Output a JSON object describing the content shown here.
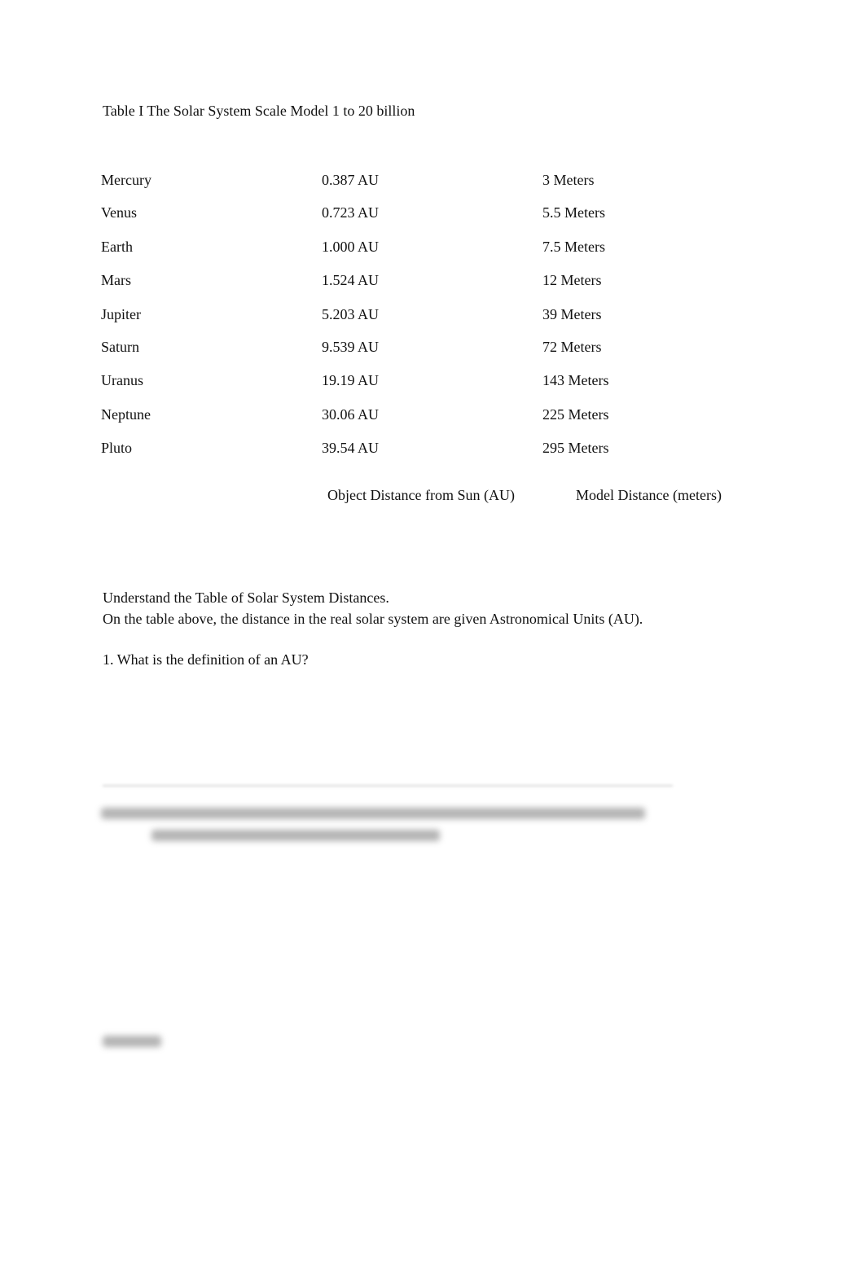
{
  "document": {
    "table_title": "Table I The Solar System Scale Model 1 to 20 billion",
    "table": {
      "columns": [
        "",
        "Object Distance from Sun (AU)",
        "Model Distance (meters)"
      ],
      "rows": [
        {
          "object": "Mercury",
          "au": "0.387 AU",
          "model": "3 Meters"
        },
        {
          "object": "Venus",
          "au": "0.723 AU",
          "model": "5.5 Meters"
        },
        {
          "object": "Earth",
          "au": "1.000 AU",
          "model": "7.5 Meters"
        },
        {
          "object": "Mars",
          "au": "1.524 AU",
          "model": "12 Meters"
        },
        {
          "object": "Jupiter",
          "au": "5.203 AU",
          "model": "39 Meters"
        },
        {
          "object": "Saturn",
          "au": "9.539 AU",
          "model": "72 Meters"
        },
        {
          "object": "Uranus",
          "au": "19.19 AU",
          "model": "143 Meters"
        },
        {
          "object": "Neptune",
          "au": "30.06 AU",
          "model": "225 Meters"
        },
        {
          "object": "Pluto",
          "au": "39.54 AU",
          "model": "295 Meters"
        }
      ]
    },
    "intro_line_1": "Understand the Table of Solar System Distances.",
    "intro_line_2": "On the table above, the distance in the real solar system are given Astronomical Units (AU).",
    "question_1": "1. What is the definition of an AU?",
    "blurred_content_note": "obscured"
  }
}
